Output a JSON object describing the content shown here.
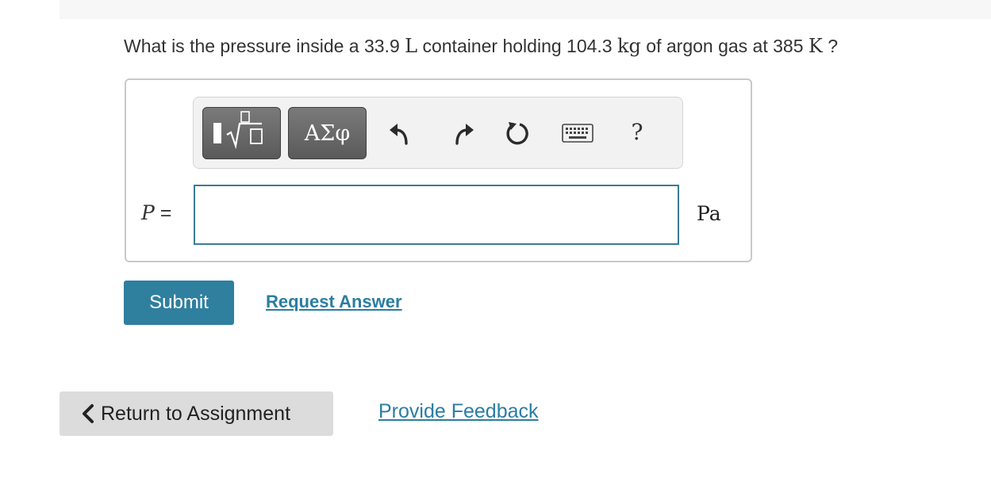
{
  "question": {
    "part1": "What is the pressure inside a 33.9 ",
    "unit_volume": "L",
    "part2": " container holding 104.3 ",
    "unit_mass": "kg",
    "part3": " of argon gas at 385 ",
    "unit_temp": "K",
    "part4": " ?"
  },
  "toolbar": {
    "templates_icon": "templates-sqrt-icon",
    "symbols_label": "ΑΣφ",
    "undo_icon": "undo-icon",
    "redo_icon": "redo-icon",
    "reset_icon": "reset-icon",
    "keyboard_icon": "keyboard-icon",
    "help_label": "?"
  },
  "answer": {
    "variable": "P",
    "equals": "=",
    "value": "",
    "unit": "Pa"
  },
  "actions": {
    "submit_label": "Submit",
    "request_answer_label": "Request Answer"
  },
  "footer": {
    "return_label": "Return to Assignment",
    "feedback_label": "Provide Feedback"
  },
  "colors": {
    "accent": "#2f7f9f",
    "link": "#2a7ea1",
    "input_border": "#3b7a99",
    "toolbar_button": "#666666"
  }
}
